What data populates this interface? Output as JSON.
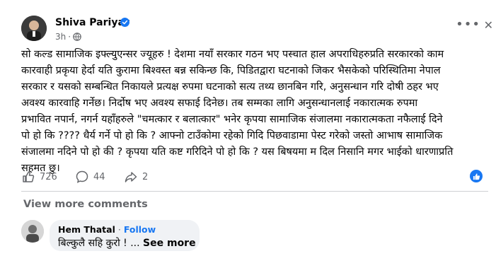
{
  "post": {
    "author": "Shiva Pariyar",
    "time": "3h",
    "time_sep": "·",
    "body": "सो कल्ड सामाजिक इफ्ल्युएन्सर ज्यूहरु ! देशमा नयाँ सरकार गठन भए पस्चात हाल अपराधिहरुप्रति सरकारको काम\nकारवाही प्रकृया हेर्दा यति कुरामा बिश्वस्त बन्न सकिन्छ कि, पिडितद्वारा घटनाको जिकर भैसकेको परिस्थितिमा नेपाल\nसरकार र यसको सम्बन्धित निकायले प्रत्यक्ष रुपमा घटनाको सत्य तथ्य छानबिन गरि, अनुसन्धान गरि दोषी ठहर भए\nअवश्य कारवाहि गर्नेछ। निर्दोष भए अवश्य सफाई दिनेछ। तब सम्मका लागि अनुसन्धानलाई नकारात्मक रुपमा\nप्रभावित नपार्न, नगर्न यहाँहरुले \"चमत्कार र बलात्कार\" भनेर कृपया सामाजिक संजालमा नकारात्मकता नफैलाई दिने\nपो हो कि ???? धैर्य गर्ने पो हो कि ? आफ्नो टाउँकोमा रहेको गिदि पिछवाडामा पेस्ट गरेको जस्तो आभाष सामाजिक\nसंजालमा नदिने पो हो की ? कृपया यति कष्ट गरिदिने पो हो कि ? यस बिषयमा म दिल निसानि मगर भाईको धारणाप्रति\nसहमत छु।"
  },
  "reactions": {
    "likes": "726",
    "comments": "44",
    "shares": "2"
  },
  "view_more_label": "View more comments",
  "comment": {
    "author": "Hem Thatal",
    "sep": "·",
    "follow_label": "Follow",
    "text": "बिल्कुलै सहि कुरो ! ...",
    "see_more_label": "See more"
  },
  "colors": {
    "accent": "#1877f2",
    "secondary_text": "#65676b",
    "bubble_bg": "#f0f2f5"
  },
  "icons": [
    "verified-icon",
    "globe-icon",
    "more-icon",
    "close-icon",
    "like-icon",
    "comment-icon",
    "share-icon",
    "liked-icon"
  ]
}
